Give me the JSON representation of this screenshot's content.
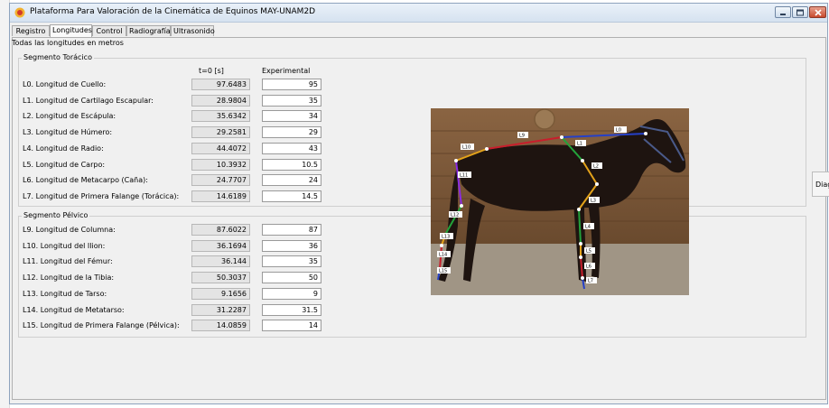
{
  "window": {
    "title": "Plataforma Para Valoración de la Cinemática de Equinos MAY-UNAM2D",
    "controls": [
      "minimize-icon",
      "maximize-icon",
      "close-icon"
    ]
  },
  "tabs": [
    {
      "label": "Registro",
      "active": false
    },
    {
      "label": "Longitudes",
      "active": true
    },
    {
      "label": "Control",
      "active": false
    },
    {
      "label": "Radiografía",
      "active": false
    },
    {
      "label": "Ultrasonido",
      "active": false
    }
  ],
  "units_note": "Todas las longitudes en metros",
  "columns": {
    "t0": "t=0 [s]",
    "experimental": "Experimental"
  },
  "thoracic": {
    "title": "Segmento Torácico",
    "rows": [
      {
        "label": "L0. Longitud de Cuello:",
        "t0": "97.6483",
        "exp": "95"
      },
      {
        "label": "L1. Longitud de Cartilago Escapular:",
        "t0": "28.9804",
        "exp": "35"
      },
      {
        "label": "L2. Longitud de Escápula:",
        "t0": "35.6342",
        "exp": "34"
      },
      {
        "label": "L3. Longitud de Húmero:",
        "t0": "29.2581",
        "exp": "29"
      },
      {
        "label": "L4. Longitud de Radio:",
        "t0": "44.4072",
        "exp": "43"
      },
      {
        "label": "L5. Longitud de Carpo:",
        "t0": "10.3932",
        "exp": "10.5"
      },
      {
        "label": "L6. Longitud de Metacarpo (Caña):",
        "t0": "24.7707",
        "exp": "24"
      },
      {
        "label": "L7. Longitud de Primera Falange (Torácica):",
        "t0": "14.6189",
        "exp": "14.5"
      }
    ]
  },
  "pelvic": {
    "title": "Segmento Pélvico",
    "rows": [
      {
        "label": "L9. Longitud de Columna:",
        "t0": "87.6022",
        "exp": "87"
      },
      {
        "label": "L10. Longitud del Ilion:",
        "t0": "36.1694",
        "exp": "36"
      },
      {
        "label": "L11. Longitud del Fémur:",
        "t0": "36.144",
        "exp": "35"
      },
      {
        "label": "L12. Longitud de la Tibia:",
        "t0": "50.3037",
        "exp": "50"
      },
      {
        "label": "L13. Longitud de Tarso:",
        "t0": "9.1656",
        "exp": "9"
      },
      {
        "label": "L14. Longitud de Metatarso:",
        "t0": "31.2287",
        "exp": "31.5"
      },
      {
        "label": "L15. Longitud de Primera Falange (Pélvica):",
        "t0": "14.0859",
        "exp": "14"
      }
    ]
  },
  "diagram_labels": [
    "L0",
    "L1",
    "L2",
    "L3",
    "L4",
    "L5",
    "L6",
    "L7",
    "L9",
    "L10",
    "L11",
    "L12",
    "L13",
    "L14",
    "L15"
  ],
  "side_button_label": "Diag",
  "colors": {
    "segment_red": "#c81e2c",
    "segment_green": "#23a23a",
    "segment_orange": "#e3a21a",
    "segment_purple": "#8a2be2",
    "segment_blue": "#2540c8"
  }
}
